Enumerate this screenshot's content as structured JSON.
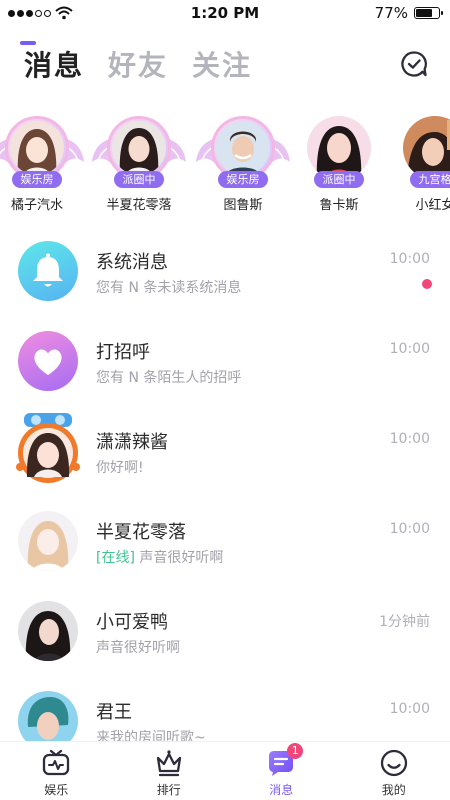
{
  "status_bar": {
    "time": "1:20 PM",
    "battery": "77%",
    "battery_level": 0.77,
    "signal_bars": 3,
    "signal_total": 5
  },
  "header": {
    "tabs": [
      {
        "label": "消息",
        "active": true
      },
      {
        "label": "好友",
        "active": false
      },
      {
        "label": "关注",
        "active": false
      }
    ],
    "action_icon": "chat-check-icon"
  },
  "colors": {
    "accent": "#7a5cf5",
    "badge_bg": "#8f6cf0",
    "unread": "#f0467a",
    "online": "#3ec48f",
    "bell_gradient_from": "#5ee7e9",
    "bell_gradient_to": "#57b3f2",
    "heart_gradient_from": "#f08ee0",
    "heart_gradient_to": "#a66cf2"
  },
  "stories": [
    {
      "name": "橘子汽水",
      "badge": "娱乐房",
      "framed": true
    },
    {
      "name": "半夏花零落",
      "badge": "派圈中",
      "framed": true
    },
    {
      "name": "图鲁斯",
      "badge": "娱乐房",
      "framed": true
    },
    {
      "name": "鲁卡斯",
      "badge": "派圈中",
      "framed": false
    },
    {
      "name": "小红女",
      "badge": "九宫格",
      "framed": false
    }
  ],
  "messages": [
    {
      "name": "系统消息",
      "preview": "您有 N 条未读系统消息",
      "time": "10:00",
      "avatar": "bell-icon",
      "unread": true
    },
    {
      "name": "打招呼",
      "preview": "您有 N 条陌生人的招呼",
      "time": "10:00",
      "avatar": "heart-icon",
      "unread": false
    },
    {
      "name": "潇潇辣酱",
      "preview": "你好啊!",
      "time": "10:00",
      "avatar": "photo",
      "unread": false
    },
    {
      "name": "半夏花零落",
      "online_tag": "[在线]",
      "preview": " 声音很好听啊",
      "time": "10:00",
      "avatar": "photo",
      "unread": false
    },
    {
      "name": "小可爱鸭",
      "preview": "声音很好听啊",
      "time": "1分钟前",
      "avatar": "photo",
      "unread": false
    },
    {
      "name": "君王",
      "preview": "来我的房间听歌~",
      "time": "10:00",
      "avatar": "photo",
      "unread": false
    }
  ],
  "bottom_nav": [
    {
      "label": "娱乐",
      "icon": "tv-icon",
      "active": false
    },
    {
      "label": "排行",
      "icon": "crown-icon",
      "active": false
    },
    {
      "label": "消息",
      "icon": "message-icon",
      "active": true,
      "badge": "1"
    },
    {
      "label": "我的",
      "icon": "smile-icon",
      "active": false
    }
  ]
}
